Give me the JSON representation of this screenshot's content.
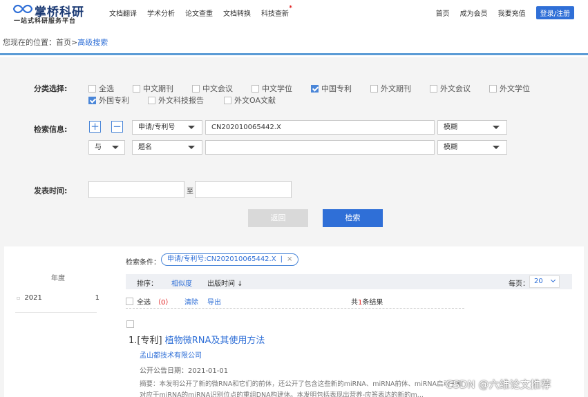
{
  "header": {
    "logo_title": "掌桥科研",
    "logo_sub": "一站式科研服务平台",
    "nav": [
      "文档翻译",
      "学术分析",
      "论文查重",
      "文档转换",
      "科技查新"
    ],
    "nav_badge": "*",
    "links": [
      "首页",
      "成为会员",
      "我要充值"
    ],
    "login": "登录/注册"
  },
  "breadcrumb": {
    "prefix": "您现在的位置：首页>",
    "current": "高级搜索"
  },
  "search": {
    "category_label": "分类选择:",
    "categories": [
      {
        "label": "全选",
        "checked": false
      },
      {
        "label": "中文期刊",
        "checked": false
      },
      {
        "label": "中文会议",
        "checked": false
      },
      {
        "label": "中文学位",
        "checked": false
      },
      {
        "label": "中国专利",
        "checked": true
      },
      {
        "label": "外文期刊",
        "checked": false
      },
      {
        "label": "外文会议",
        "checked": false
      },
      {
        "label": "外文学位",
        "checked": false
      },
      {
        "label": "外国专利",
        "checked": true
      },
      {
        "label": "外文科技报告",
        "checked": false
      },
      {
        "label": "外文OA文献",
        "checked": false
      }
    ],
    "info_label": "检索信息:",
    "add_symbol": "+",
    "remove_symbol": "−",
    "row1": {
      "field": "申请/专利号",
      "value": "CN202010065442.X",
      "match": "模糊"
    },
    "row2": {
      "logic": "与",
      "field": "题名",
      "value": "",
      "match": "模糊"
    },
    "date_label": "发表时间:",
    "date_to": "至",
    "back_button": "返回",
    "search_button": "检索"
  },
  "results": {
    "facet_title": "年度",
    "facet_items": [
      {
        "label": "2021",
        "count": "1"
      }
    ],
    "facet_bullet": "▫",
    "condition_label": "检索条件：",
    "condition_tag": "申请/专利号:CN202010065442.X",
    "condition_sep": "|",
    "condition_close": "×",
    "sort_label": "排序：",
    "sort_relevance": "相似度",
    "sort_date": "出版时间 ↓",
    "per_page_label": "每页：",
    "per_page_value": "20",
    "select_all": "全选",
    "selected_count_open": "（",
    "selected_count": "0",
    "selected_count_close": "）",
    "clear": "清除",
    "export": "导出",
    "total_prefix": "共",
    "total_count": "1",
    "total_suffix": "条结果",
    "item": {
      "index_type": "1.[专利]",
      "title": "植物微RNA及其使用方法",
      "org": "孟山都技术有限公司",
      "date": "公开公告日期：2021-01-01",
      "abstract": "摘要：本发明公开了新的微RNA和它们的前体，还公开了包含这些新的miRNA、miRNA前体、miRNA启动子和对应于miRNA的miRNA识别位点的重组DNA构建体。本发明包括表现出营养-应答表达的新的m..."
    }
  },
  "watermark": "CSDN @六维论文推荐",
  "colors": {
    "accent": "#2f6fd7",
    "badge": "#e02020",
    "panel": "#f4f4f4"
  }
}
